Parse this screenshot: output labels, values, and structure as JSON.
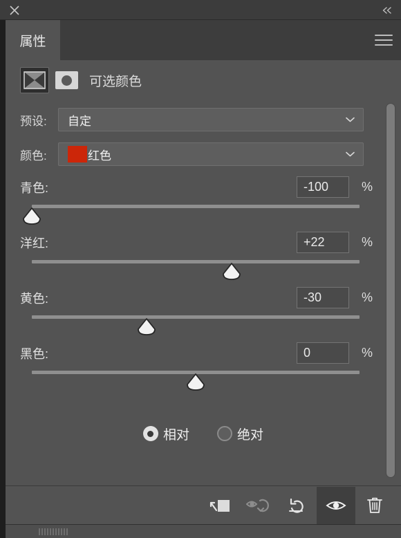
{
  "window": {
    "close_icon": "close-icon",
    "collapse_icon": "collapse-double-chevron-icon",
    "collapse_label": "«"
  },
  "tabs": [
    {
      "label": "属性",
      "active": true
    }
  ],
  "panel_menu": {
    "icon": "hamburger-menu-icon"
  },
  "adjustment": {
    "icon": "selective-color-adjustment-icon",
    "mask_icon": "layer-mask-thumbnail-icon",
    "title": "可选颜色"
  },
  "preset": {
    "label": "预设:",
    "value": "自定",
    "chevron_icon": "chevron-down-icon"
  },
  "color_select": {
    "label": "颜色:",
    "value": "红色",
    "swatch_color": "#cc2609",
    "chevron_icon": "chevron-down-icon"
  },
  "sliders": [
    {
      "label": "青色:",
      "value": "-100",
      "unit": "%",
      "position_pct": 0,
      "name": "cyan"
    },
    {
      "label": "洋红:",
      "value": "+22",
      "unit": "%",
      "position_pct": 61,
      "name": "magenta"
    },
    {
      "label": "黄色:",
      "value": "-30",
      "unit": "%",
      "position_pct": 35,
      "name": "yellow"
    },
    {
      "label": "黑色:",
      "value": "0",
      "unit": "%",
      "position_pct": 50,
      "name": "black"
    }
  ],
  "method": {
    "options": [
      {
        "label": "相对",
        "selected": true
      },
      {
        "label": "绝对",
        "selected": false
      }
    ]
  },
  "toolbar": {
    "buttons": [
      {
        "icon": "clip-to-layer-icon",
        "active": false,
        "disabled": false
      },
      {
        "icon": "view-previous-state-icon",
        "active": false,
        "disabled": true
      },
      {
        "icon": "reset-icon",
        "active": false,
        "disabled": false
      },
      {
        "icon": "toggle-visibility-eye-icon",
        "active": true,
        "disabled": false
      },
      {
        "icon": "delete-trash-icon",
        "active": false,
        "disabled": false
      }
    ]
  },
  "colors": {
    "panel_bg": "#535353",
    "titlebar_bg": "#3c3c3c",
    "tabstrip_bg": "#3d3d3d",
    "accent_red": "#cc2609",
    "text": "#e0e0e0"
  }
}
